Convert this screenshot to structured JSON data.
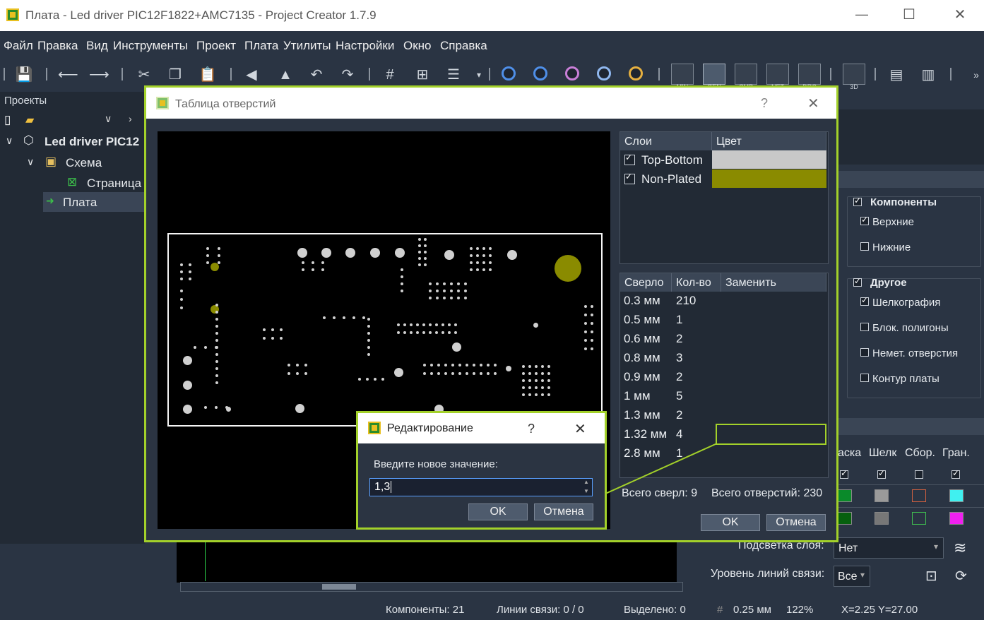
{
  "window": {
    "title": "Плата - Led driver PIC12F1822+AMC7135 - Project Creator 1.7.9"
  },
  "menu": [
    "Файл",
    "Правка",
    "Вид",
    "Инструменты",
    "Проект",
    "Плата",
    "Утилиты",
    "Настройки",
    "Окно",
    "Справка"
  ],
  "toolbar": {
    "min": "MIN",
    "gen": "GEN",
    "cmp": "CMP",
    "net": "NET",
    "drc": "DRC",
    "d3": "3D"
  },
  "projects": {
    "header": "Проекты",
    "tree": [
      "Led driver PIC12",
      "Схема",
      "Страница",
      "Плата"
    ]
  },
  "dialog": {
    "title": "Таблица отверстий",
    "help": "?",
    "layers": {
      "col_layer": "Слои",
      "col_color": "Цвет",
      "rows": [
        {
          "name": "Top-Bottom",
          "color": "#c8c8c8",
          "checked": true
        },
        {
          "name": "Non-Plated",
          "color": "#8a8b00",
          "checked": true
        }
      ]
    },
    "drills": {
      "col_drill": "Сверло",
      "col_count": "Кол-во",
      "col_replace": "Заменить",
      "rows": [
        {
          "drill": "0.3 мм",
          "count": "210"
        },
        {
          "drill": "0.5 мм",
          "count": "1"
        },
        {
          "drill": "0.6 мм",
          "count": "2"
        },
        {
          "drill": "0.8 мм",
          "count": "3"
        },
        {
          "drill": "0.9 мм",
          "count": "2"
        },
        {
          "drill": "1 мм",
          "count": "5"
        },
        {
          "drill": "1.3 мм",
          "count": "2"
        },
        {
          "drill": "1.32 мм",
          "count": "4"
        },
        {
          "drill": "2.8 мм",
          "count": "1"
        }
      ]
    },
    "total_drills": "Всего сверл: 9",
    "total_holes": "Всего отверстий: 230",
    "ok": "OK",
    "cancel": "Отмена"
  },
  "edit": {
    "title": "Редактирование",
    "help": "?",
    "prompt": "Введите новое значение:",
    "value": "1,3",
    "ok": "OK",
    "cancel": "Отмена"
  },
  "right": {
    "components": "Компоненты",
    "top": "Верхние",
    "bottom": "Нижние",
    "other": "Другое",
    "silk": "Шелкография",
    "block": "Блок. полигоны",
    "nonplated": "Немет. отверстия",
    "outline": "Контур платы",
    "cols": [
      "аска",
      "Шелк",
      "Сбор.",
      "Гран."
    ],
    "highlight_label": "Подсветка слоя:",
    "highlight_value": "Нет",
    "ratsnest_label": "Уровень линий связи:",
    "ratsnest_value": "Все"
  },
  "status": {
    "components": "Компоненты: 21",
    "links": "Линии связи: 0 / 0",
    "selected": "Выделено: 0",
    "grid": "0.25 мм",
    "zoom": "122%",
    "coords": "X=2.25  Y=27.00"
  }
}
